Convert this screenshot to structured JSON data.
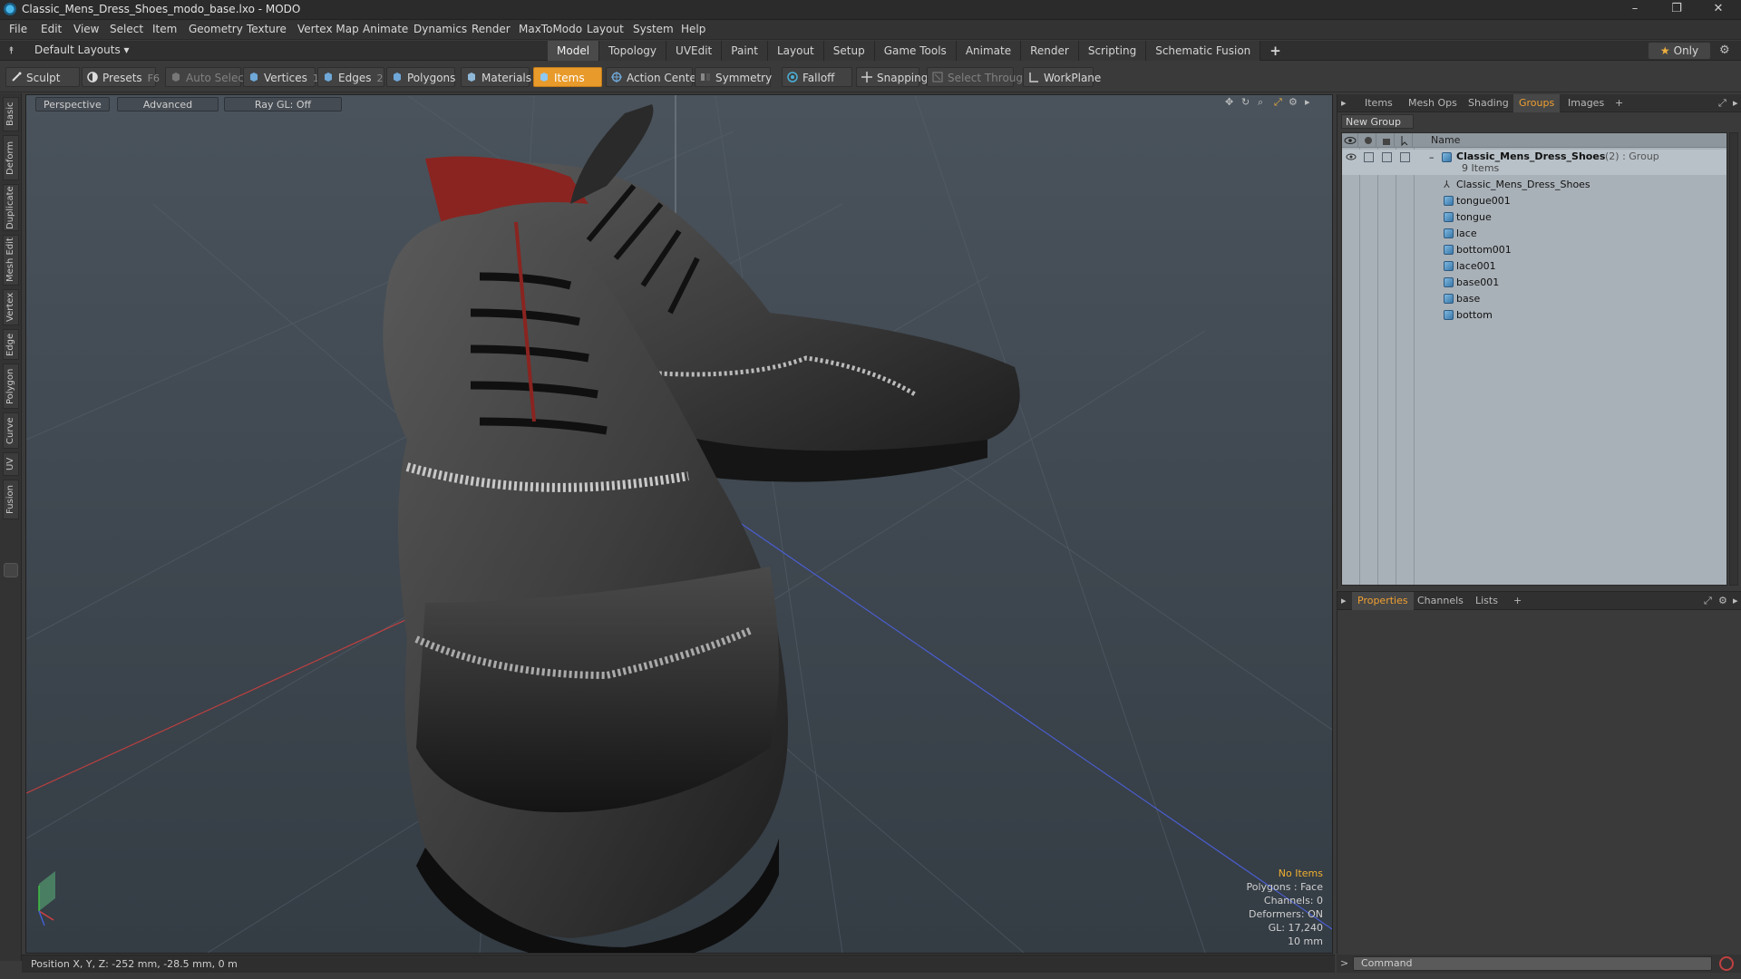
{
  "window": {
    "title": "Classic_Mens_Dress_Shoes_modo_base.lxo - MODO",
    "minimize": "–",
    "restore": "❐",
    "close": "✕"
  },
  "menu": [
    "File",
    "Edit",
    "View",
    "Select",
    "Item",
    "Geometry",
    "Texture",
    "Vertex Map",
    "Animate",
    "Dynamics",
    "Render",
    "MaxToModo",
    "Layout",
    "System",
    "Help"
  ],
  "layout_select": "Default Layouts ▾",
  "layout_tabs": [
    {
      "label": "Model",
      "active": true
    },
    {
      "label": "Topology",
      "active": false
    },
    {
      "label": "UVEdit",
      "active": false
    },
    {
      "label": "Paint",
      "active": false
    },
    {
      "label": "Layout",
      "active": false
    },
    {
      "label": "Setup",
      "active": false
    },
    {
      "label": "Game Tools",
      "active": false
    },
    {
      "label": "Animate",
      "active": false
    },
    {
      "label": "Render",
      "active": false
    },
    {
      "label": "Scripting",
      "active": false
    },
    {
      "label": "Schematic Fusion",
      "active": false
    }
  ],
  "add_tab": "+",
  "only_label": "Only",
  "toolbar": {
    "sculpt": "Sculpt",
    "presets": "Presets",
    "presets_key": "F6",
    "auto_select": "Auto Select",
    "vertices": "Vertices",
    "vertices_key": "1",
    "edges": "Edges",
    "edges_key": "2",
    "polygons": "Polygons",
    "materials": "Materials",
    "items": "Items",
    "action_center": "Action Center",
    "symmetry": "Symmetry",
    "falloff": "Falloff",
    "snapping": "Snapping",
    "select_through": "Select Through",
    "workplane": "WorkPlane"
  },
  "left_tabs": [
    "Basic",
    "Deform",
    "Duplicate",
    "Mesh Edit",
    "Vertex",
    "Edge",
    "Polygon",
    "Curve",
    "UV",
    "Fusion"
  ],
  "viewport": {
    "perspective": "Perspective",
    "advanced": "Advanced",
    "raygl": "Ray GL: Off",
    "info": {
      "items": "No Items",
      "polygons": "Polygons : Face",
      "channels": "Channels: 0",
      "deformers": "Deformers: ON",
      "gl": "GL: 17,240",
      "scale": "10 mm"
    }
  },
  "status": "Position X, Y, Z:  -252 mm, -28.5 mm, 0 m",
  "scene_panel": {
    "tabs": [
      {
        "label": "Items",
        "active": false
      },
      {
        "label": "Mesh Ops",
        "active": false
      },
      {
        "label": "Shading",
        "active": false
      },
      {
        "label": "Groups",
        "active": true
      },
      {
        "label": "Images",
        "active": false
      }
    ],
    "add": "+",
    "new_group": "New Group",
    "name_header": "Name",
    "group": {
      "name": "Classic_Mens_Dress_Shoes",
      "suffix": "(2) : Group",
      "count": "9 Items"
    },
    "items": [
      "Classic_Mens_Dress_Shoes",
      "tongue001",
      "tongue",
      "lace",
      "bottom001",
      "lace001",
      "base001",
      "base",
      "bottom"
    ]
  },
  "props_panel": {
    "tabs": [
      {
        "label": "Properties",
        "active": true
      },
      {
        "label": "Channels",
        "active": false
      },
      {
        "label": "Lists",
        "active": false
      }
    ],
    "add": "+"
  },
  "command": {
    "placeholder": "Command",
    "prompt": ">"
  },
  "colors": {
    "accent": "#e89a2a",
    "viewport_bg": "#3d4650",
    "tree_bg": "#a9b1b8"
  }
}
